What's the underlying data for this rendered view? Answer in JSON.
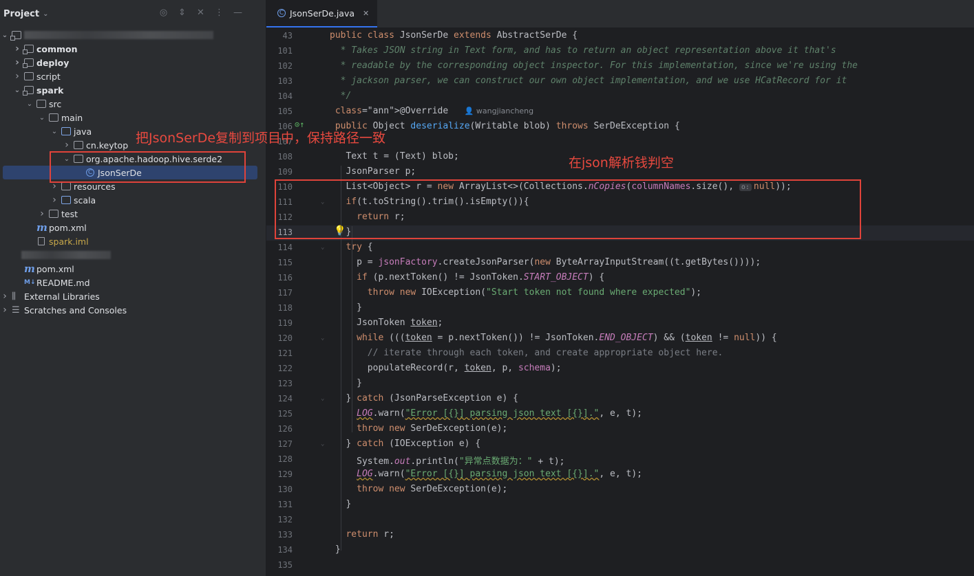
{
  "sidebar": {
    "title": "Project",
    "tree": [
      {
        "label": "",
        "arrow": "down",
        "icon": "module-folder",
        "bold": true,
        "blurred": true,
        "depth": 0
      },
      {
        "label": "common",
        "arrow": "right",
        "icon": "module-folder",
        "bold": true,
        "depth": 1
      },
      {
        "label": "deploy",
        "arrow": "right",
        "icon": "module-folder",
        "bold": true,
        "depth": 1
      },
      {
        "label": "script",
        "arrow": "right",
        "icon": "folder",
        "bold": false,
        "depth": 1
      },
      {
        "label": "spark",
        "arrow": "down",
        "icon": "module-folder",
        "bold": true,
        "depth": 1
      },
      {
        "label": "src",
        "arrow": "down",
        "icon": "folder",
        "depth": 2
      },
      {
        "label": "main",
        "arrow": "down",
        "icon": "folder",
        "depth": 3
      },
      {
        "label": "java",
        "arrow": "down",
        "icon": "folder-blue",
        "depth": 4
      },
      {
        "label": "cn.keytop",
        "arrow": "right",
        "icon": "folder",
        "depth": 5
      },
      {
        "label": "org.apache.hadoop.hive.serde2",
        "arrow": "down",
        "icon": "folder",
        "depth": 5
      },
      {
        "label": "JsonSerDe",
        "arrow": "",
        "icon": "class",
        "depth": 6,
        "selected": true
      },
      {
        "label": "resources",
        "arrow": "right",
        "icon": "folder",
        "depth": 4
      },
      {
        "label": "scala",
        "arrow": "right",
        "icon": "folder-blue",
        "depth": 4
      },
      {
        "label": "test",
        "arrow": "right",
        "icon": "folder",
        "depth": 3
      },
      {
        "label": "pom.xml",
        "arrow": "",
        "icon": "maven",
        "depth": 2
      },
      {
        "label": "spark.iml",
        "arrow": "",
        "icon": "iml",
        "depth": 2
      },
      {
        "label": "",
        "arrow": "",
        "icon": "none",
        "depth": 1,
        "blurred": true
      },
      {
        "label": "pom.xml",
        "arrow": "",
        "icon": "maven",
        "depth": 1
      },
      {
        "label": "README.md",
        "arrow": "",
        "icon": "markdown",
        "depth": 1
      },
      {
        "label": "External Libraries",
        "arrow": "right",
        "icon": "library",
        "depth": 0
      },
      {
        "label": "Scratches and Consoles",
        "arrow": "right",
        "icon": "scratches",
        "depth": 0
      }
    ]
  },
  "editor": {
    "tab_label": "JsonSerDe.java",
    "author_hint": "wangjiancheng",
    "param_hint": "o:",
    "current_line": "113",
    "lines": [
      {
        "n": "43",
        "code": "public class JsonSerDe extends AbstractSerDe {"
      },
      {
        "n": "101",
        "code": "  * Takes JSON string in Text form, and has to return an object representation above it that's"
      },
      {
        "n": "102",
        "code": "  * readable by the corresponding object inspector. For this implementation, since we're using the"
      },
      {
        "n": "103",
        "code": "  * jackson parser, we can construct our own object implementation, and we use HCatRecord for it"
      },
      {
        "n": "104",
        "code": "  */"
      },
      {
        "n": "105",
        "code": " @Override"
      },
      {
        "n": "106",
        "code": " public Object deserialize(Writable blob) throws SerDeException {"
      },
      {
        "n": "107",
        "code": ""
      },
      {
        "n": "108",
        "code": "   Text t = (Text) blob;"
      },
      {
        "n": "109",
        "code": "   JsonParser p;"
      },
      {
        "n": "110",
        "code": "   List<Object> r = new ArrayList<>(Collections.nCopies(columnNames.size(), null));"
      },
      {
        "n": "111",
        "code": "   if(t.toString().trim().isEmpty()){"
      },
      {
        "n": "112",
        "code": "     return r;"
      },
      {
        "n": "113",
        "code": "   }"
      },
      {
        "n": "114",
        "code": "   try {"
      },
      {
        "n": "115",
        "code": "     p = jsonFactory.createJsonParser(new ByteArrayInputStream((t.getBytes())));"
      },
      {
        "n": "116",
        "code": "     if (p.nextToken() != JsonToken.START_OBJECT) {"
      },
      {
        "n": "117",
        "code": "       throw new IOException(\"Start token not found where expected\");"
      },
      {
        "n": "118",
        "code": "     }"
      },
      {
        "n": "119",
        "code": "     JsonToken token;"
      },
      {
        "n": "120",
        "code": "     while (((token = p.nextToken()) != JsonToken.END_OBJECT) && (token != null)) {"
      },
      {
        "n": "121",
        "code": "       // iterate through each token, and create appropriate object here."
      },
      {
        "n": "122",
        "code": "       populateRecord(r, token, p, schema);"
      },
      {
        "n": "123",
        "code": "     }"
      },
      {
        "n": "124",
        "code": "   } catch (JsonParseException e) {"
      },
      {
        "n": "125",
        "code": "     LOG.warn(\"Error [{}] parsing json text [{}].\", e, t);"
      },
      {
        "n": "126",
        "code": "     throw new SerDeException(e);"
      },
      {
        "n": "127",
        "code": "   } catch (IOException e) {"
      },
      {
        "n": "128",
        "code": "     System.out.println(\"异常点数据为：\" + t);"
      },
      {
        "n": "129",
        "code": "     LOG.warn(\"Error [{}] parsing json text [{}].\", e, t);"
      },
      {
        "n": "130",
        "code": "     throw new SerDeException(e);"
      },
      {
        "n": "131",
        "code": "   }"
      },
      {
        "n": "132",
        "code": ""
      },
      {
        "n": "133",
        "code": "   return r;"
      },
      {
        "n": "134",
        "code": " }"
      },
      {
        "n": "135",
        "code": ""
      }
    ]
  },
  "annotations": {
    "copy_note": "把JsonSerDe复制到项目中，保持路径一致",
    "empty_check_note": "在json解析钱判空"
  },
  "colors": {
    "annotation_red": "#e0433a",
    "keyword": "#cf8e6d",
    "string": "#6aab73",
    "selection": "#2e436e"
  }
}
